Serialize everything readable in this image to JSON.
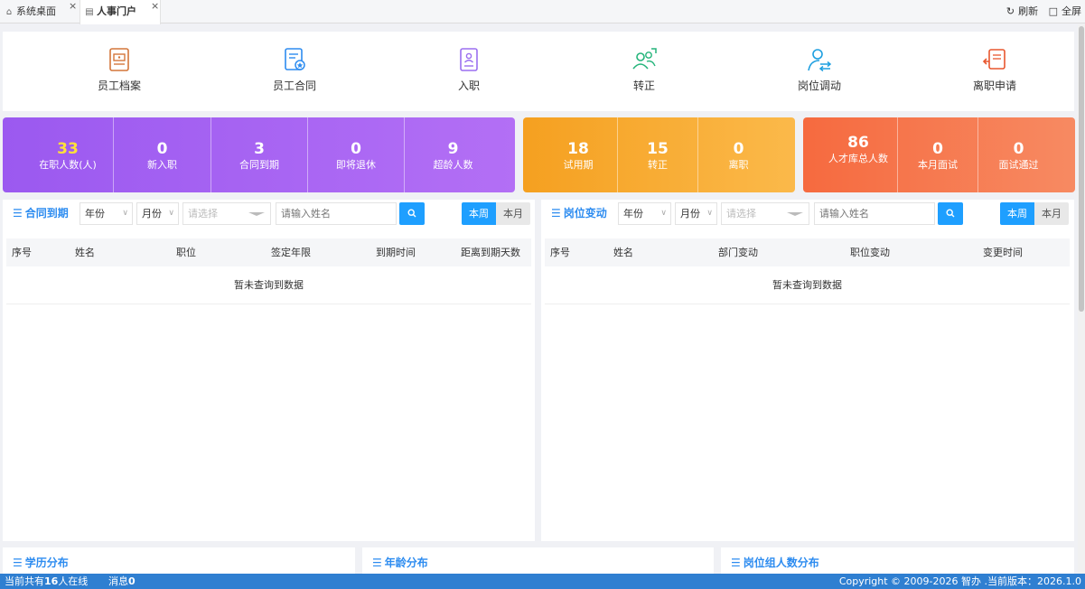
{
  "tabs": [
    {
      "label": "系统桌面",
      "icon": "home-icon"
    },
    {
      "label": "人事门户",
      "icon": "document-icon"
    }
  ],
  "toolbar": {
    "refresh_label": "刷新",
    "fullscreen_label": "全屏"
  },
  "quick_entries": [
    {
      "label": "员工档案",
      "icon": "archive-icon",
      "color": "#d4763a"
    },
    {
      "label": "员工合同",
      "icon": "contract-icon",
      "color": "#2d8cf0"
    },
    {
      "label": "入职",
      "icon": "onboard-icon",
      "color": "#9b6ff0"
    },
    {
      "label": "转正",
      "icon": "promote-icon",
      "color": "#23b47a"
    },
    {
      "label": "岗位调动",
      "icon": "transfer-icon",
      "color": "#1e9fe0"
    },
    {
      "label": "离职申请",
      "icon": "resign-icon",
      "color": "#e8572f"
    }
  ],
  "stats": {
    "purple": [
      {
        "value": "33",
        "label": "在职人数(人)"
      },
      {
        "value": "0",
        "label": "新入职"
      },
      {
        "value": "3",
        "label": "合同到期"
      },
      {
        "value": "0",
        "label": "即将退休"
      },
      {
        "value": "9",
        "label": "超龄人数"
      }
    ],
    "orange": [
      {
        "value": "18",
        "label": "试用期"
      },
      {
        "value": "15",
        "label": "转正"
      },
      {
        "value": "0",
        "label": "离职"
      }
    ],
    "red": [
      {
        "value": "86",
        "label": "人才库总人数"
      },
      {
        "value": "0",
        "label": "本月面试"
      },
      {
        "value": "0",
        "label": "面试通过"
      }
    ]
  },
  "contract_panel": {
    "title": "合同到期",
    "year_select": "年份",
    "month_select": "月份",
    "dept_select_placeholder": "请选择",
    "name_input_placeholder": "请输入姓名",
    "week_label": "本周",
    "month_label": "本月",
    "columns": [
      "序号",
      "姓名",
      "职位",
      "签定年限",
      "到期时间",
      "距离到期天数"
    ],
    "empty_text": "暂未查询到数据"
  },
  "position_panel": {
    "title": "岗位变动",
    "year_select": "年份",
    "month_select": "月份",
    "dept_select_placeholder": "请选择",
    "name_input_placeholder": "请输入姓名",
    "week_label": "本周",
    "month_label": "本月",
    "columns": [
      "序号",
      "姓名",
      "部门变动",
      "职位变动",
      "变更时间"
    ],
    "empty_text": "暂未查询到数据"
  },
  "bottom_panels": [
    {
      "title": "学历分布"
    },
    {
      "title": "年龄分布"
    },
    {
      "title": "岗位组人数分布"
    }
  ],
  "status_bar": {
    "online_prefix": "当前共有",
    "online_count": "16",
    "online_suffix": "人在线",
    "message_label": "消息",
    "message_count": "0",
    "copyright": "Copyright © 2009-2026 智办 .当前版本：2026.1.0"
  }
}
